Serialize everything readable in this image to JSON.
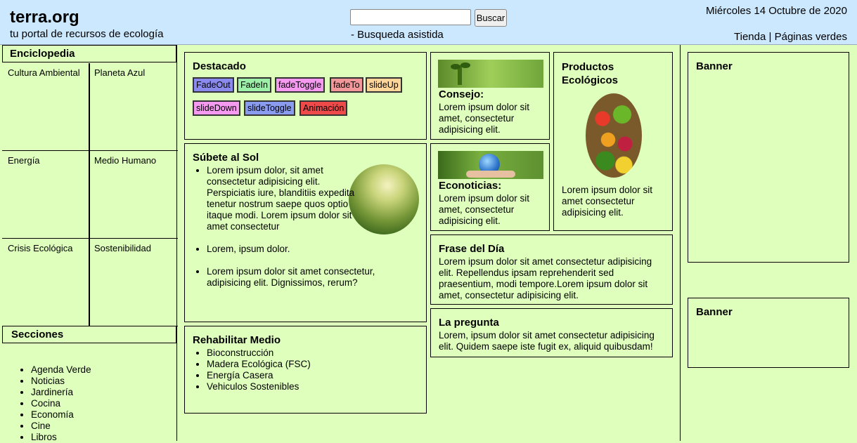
{
  "header": {
    "title": "terra.org",
    "subtitle": "tu portal de recursos de ecología",
    "search_button": "Buscar",
    "search_value": "",
    "assist": "- Busqueda asistida",
    "date": "Miércoles 14 Octubre de 2020",
    "link_shop": "Tienda",
    "link_sep": "|",
    "link_pages": "Páginas verdes"
  },
  "encyclopedia": {
    "heading": "Enciclopedia",
    "items": [
      "Cultura Ambiental",
      "Planeta Azul",
      "Energía",
      "Medio Humano",
      "Crisis Ecológica",
      "Sostenibilidad"
    ]
  },
  "sections": {
    "heading": "Secciones",
    "items": [
      "Agenda Verde",
      "Noticias",
      "Jardinería",
      "Cocina",
      "Economía",
      "Cine",
      "Libros"
    ]
  },
  "featured": {
    "heading": "Destacado",
    "buttons": [
      {
        "label": "FadeOut",
        "color": "#8a8aee"
      },
      {
        "label": "FadeIn",
        "color": "#9cf0a8"
      },
      {
        "label": "fadeToggle",
        "color": "#f59af0"
      },
      {
        "label": "fadeTo",
        "color": "#f2989a"
      },
      {
        "label": "slideUp",
        "color": "#ffd59a"
      },
      {
        "label": "slideDown",
        "color": "#f59af0"
      },
      {
        "label": "slideToggle",
        "color": "#8a9cf0"
      },
      {
        "label": "Animación",
        "color": "#ee4a4a"
      }
    ]
  },
  "sun": {
    "heading": "Súbete al Sol",
    "items": [
      "Lorem ipsum dolor, sit amet consectetur adipisicing elit. Perspiciatis iure, blanditiis expedita tenetur nostrum saepe quos optio itaque modi. Lorem ipsum dolor sit amet consectetur",
      "Lorem, ipsum dolor.",
      "Lorem ipsum dolor sit amet consectetur, adipisicing elit. Dignissimos, rerum?"
    ]
  },
  "rehab": {
    "heading": "Rehabilitar Medio",
    "items": [
      "Bioconstrucción",
      "Madera Ecológica (FSC)",
      "Energía Casera",
      "Vehiculos Sostenibles"
    ]
  },
  "tip": {
    "heading": "Consejo:",
    "text": "Lorem ipsum dolor sit amet, consectetur adipisicing elit."
  },
  "econews": {
    "heading": "Econoticias:",
    "text": "Lorem ipsum dolor sit amet, consectetur adipisicing elit."
  },
  "products": {
    "heading": "Productos Ecológicos",
    "text": "Lorem ipsum dolor sit amet consectetur adipisicing elit."
  },
  "phrase": {
    "heading": "Frase del Día",
    "text": "Lorem ipsum dolor sit amet consectetur adipisicing elit. Repellendus ipsam reprehenderit sed praesentium, modi tempore.Lorem ipsum dolor sit amet, consectetur adipisicing elit."
  },
  "question": {
    "heading": "La pregunta",
    "text": "Lorem, ipsum dolor sit amet consectetur adipisicing elit. Quidem saepe iste fugit ex, aliquid quibusdam!"
  },
  "banners": [
    "Banner",
    "Banner"
  ],
  "colors": {
    "header_bg": "#cce8ff",
    "page_bg": "#dfffbd"
  }
}
